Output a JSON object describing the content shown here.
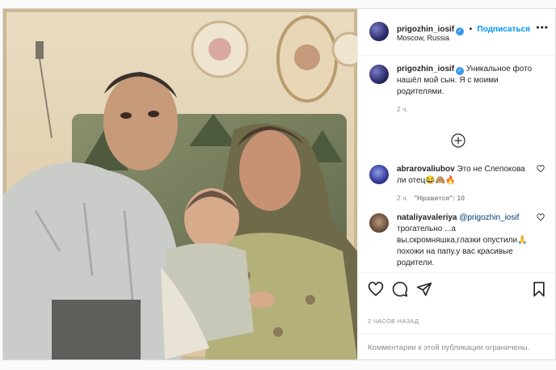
{
  "header": {
    "username": "prigozhin_iosif",
    "follow_label": "Подписаться",
    "location": "Moscow, Russia",
    "separator": "•",
    "more_label": "•••"
  },
  "caption": {
    "username": "prigozhin_iosif",
    "text": "Уникальное фото нашёл мой сын. Я с моими родителями.",
    "time": "2 ч."
  },
  "comments": [
    {
      "username": "abrarovaliubov",
      "text": "Это не Слепокова ли отец😂🙈🔥",
      "time": "2 ч.",
      "likes": "\"Нравится\": 10"
    },
    {
      "username": "nataliyavaleriya",
      "mention": "@prigozhin_iosif",
      "text": "трогательно ...а вы,скромняшка,глазки опустили🙏похожи на папу.у вас красивые родители."
    }
  ],
  "actions": {
    "icons": [
      "heart-icon",
      "comment-icon",
      "share-icon",
      "bookmark-icon"
    ]
  },
  "timestamp": "2 ЧАСОВ НАЗАД",
  "footer": {
    "comments_limited": "Комментарии к этой публикации ограничены."
  },
  "colors": {
    "accent": "#0095f6",
    "verified": "#3897f0",
    "muted": "#8e8e8e",
    "border": "#dbdbdb"
  }
}
